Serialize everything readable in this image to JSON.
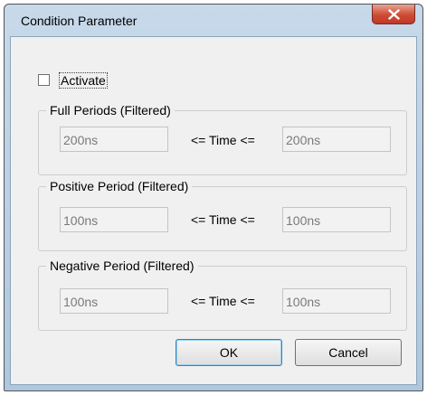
{
  "window": {
    "title": "Condition Parameter",
    "close_icon": "close-icon"
  },
  "activate": {
    "label": "Activate",
    "checked": false
  },
  "groups": [
    {
      "title": "Full Periods (Filtered)",
      "min": "200ns",
      "relation": "<= Time <=",
      "max": "200ns"
    },
    {
      "title": "Positive Period (Filtered)",
      "min": "100ns",
      "relation": "<= Time <=",
      "max": "100ns"
    },
    {
      "title": "Negative Period (Filtered)",
      "min": "100ns",
      "relation": "<= Time <=",
      "max": "100ns"
    }
  ],
  "buttons": {
    "ok_label": "OK",
    "cancel_label": "Cancel"
  },
  "colors": {
    "close_button": "#c9432f",
    "dialog_background": "#f0f0f0",
    "frame": "#b8cfe4"
  }
}
